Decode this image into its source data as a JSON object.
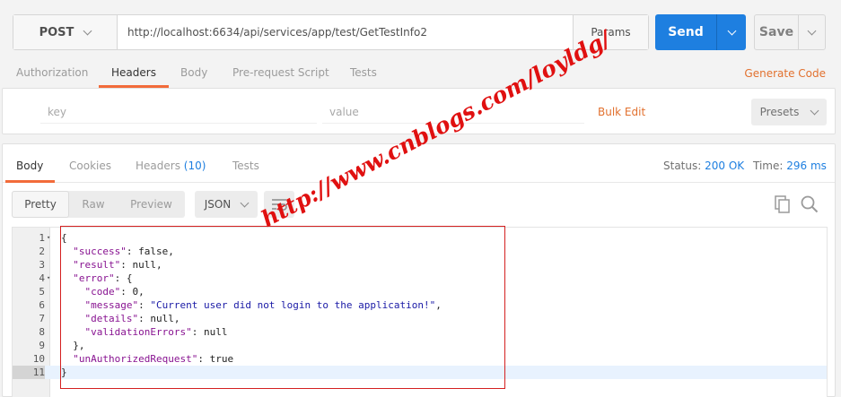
{
  "request": {
    "method": "POST",
    "url": "http://localhost:6634/api/services/app/test/GetTestInfo2",
    "params_label": "Params",
    "send_label": "Send",
    "save_label": "Save"
  },
  "request_tabs": [
    "Authorization",
    "Headers",
    "Body",
    "Pre-request Script",
    "Tests"
  ],
  "generate_code_label": "Generate Code",
  "headers_panel": {
    "key_placeholder": "key",
    "value_placeholder": "value",
    "bulk_edit_label": "Bulk Edit",
    "presets_label": "Presets"
  },
  "response": {
    "tabs": [
      "Body",
      "Cookies",
      "Headers",
      "Tests"
    ],
    "headers_count": "(10)",
    "status_label": "Status:",
    "status_value": "200 OK",
    "time_label": "Time:",
    "time_value": "296 ms",
    "view_modes": [
      "Pretty",
      "Raw",
      "Preview"
    ],
    "format": "JSON"
  },
  "code_lines": [
    "{",
    "  \"success\": false,",
    "  \"result\": null,",
    "  \"error\": {",
    "    \"code\": 0,",
    "    \"message\": \"Current user did not login to the application!\",",
    "    \"details\": null,",
    "    \"validationErrors\": null",
    "  },",
    "  \"unAuthorizedRequest\": true",
    "}"
  ],
  "line_numbers": [
    "1",
    "2",
    "3",
    "4",
    "5",
    "6",
    "7",
    "8",
    "9",
    "10",
    "11"
  ],
  "watermark": "http://www.cnblogs.com/loyldg/",
  "colors": {
    "accent": "#f26b3a",
    "send": "#1e7fe0",
    "link": "#e2712f",
    "annotation": "#d42020"
  }
}
